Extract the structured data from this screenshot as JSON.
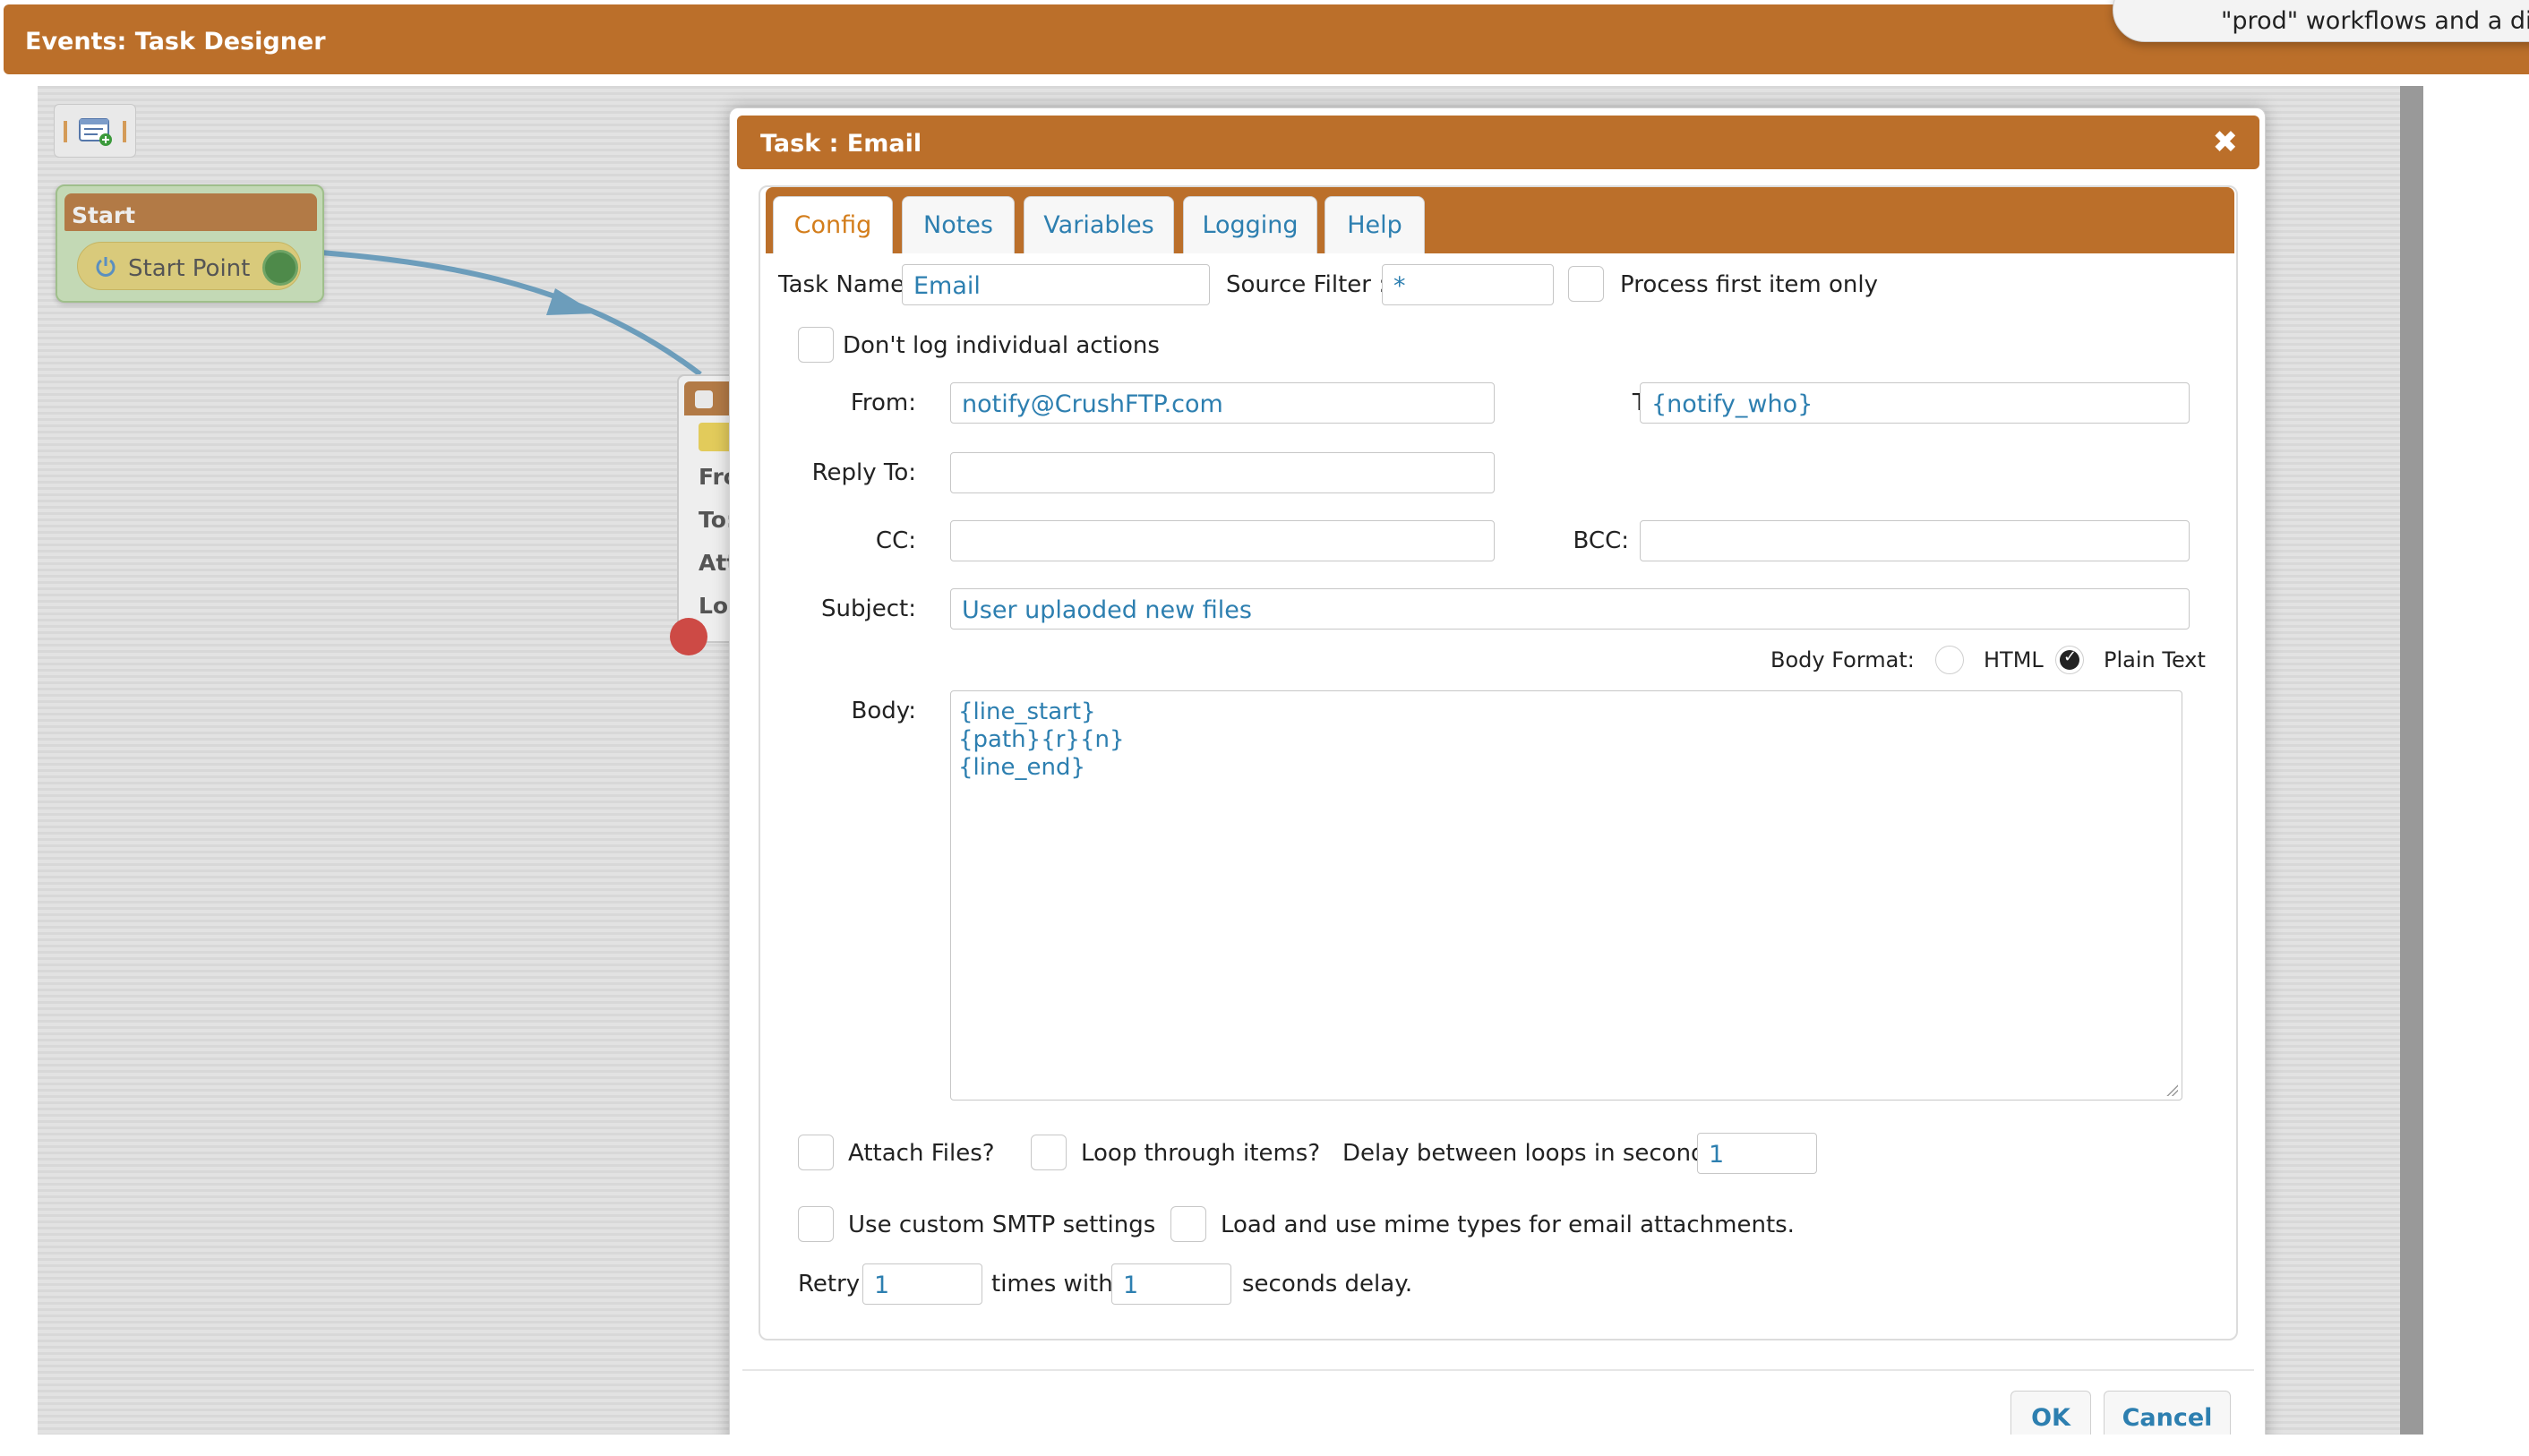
{
  "window": {
    "title": "Events: Task Designer"
  },
  "tooltip": {
    "text": "\"prod\" workflows and a diffe"
  },
  "canvas": {
    "start_node": {
      "header": "Start",
      "item": "Start Point"
    },
    "email_node": {
      "lines": [
        "Fro",
        "To:",
        "Att",
        "Loc"
      ]
    }
  },
  "dialog": {
    "title": "Task : Email",
    "close_icon": "✖",
    "tabs": [
      {
        "label": "Config",
        "active": true
      },
      {
        "label": "Notes"
      },
      {
        "label": "Variables"
      },
      {
        "label": "Logging"
      },
      {
        "label": "Help"
      }
    ],
    "config": {
      "task_name_label": "Task Name:",
      "task_name_value": "Email",
      "source_filter_label": "Source Filter :",
      "source_filter_value": "*",
      "process_first_label": "Process first item only",
      "dont_log_label": "Don't log individual actions",
      "from_label": "From:",
      "from_value": "notify@CrushFTP.com",
      "to_label": "To:",
      "to_value": "{notify_who}",
      "reply_to_label": "Reply To:",
      "reply_to_value": "",
      "cc_label": "CC:",
      "cc_value": "",
      "bcc_label": "BCC:",
      "bcc_value": "",
      "subject_label": "Subject:",
      "subject_value": "User uplaoded new files",
      "body_format_label": "Body Format:",
      "body_format_html": "HTML",
      "body_format_plain": "Plain Text",
      "body_format_selected": "Plain Text",
      "body_label": "Body:",
      "body_lines": [
        "{line_start}",
        "{path}{r}{n}",
        "{line_end}"
      ],
      "attach_files_label": "Attach Files?",
      "loop_items_label": "Loop through items?",
      "delay_label": "Delay between loops in seconds:",
      "delay_value": "1",
      "custom_smtp_label": "Use custom SMTP settings",
      "mime_types_label": "Load and use mime types for email attachments.",
      "retry_label": "Retry",
      "retry_value": "1",
      "times_with_label": "times with",
      "seconds_value": "1",
      "seconds_delay_label": "seconds delay."
    },
    "buttons": {
      "ok": "OK",
      "cancel": "Cancel"
    }
  },
  "colors": {
    "accent": "#bb6f2a",
    "link": "#2d7fb0",
    "active_tab": "#d37d1b",
    "canvas": "#dddddd"
  },
  "icons": {
    "toolbar": "workflow-list-icon",
    "start": "power-icon",
    "close": "close-icon"
  }
}
